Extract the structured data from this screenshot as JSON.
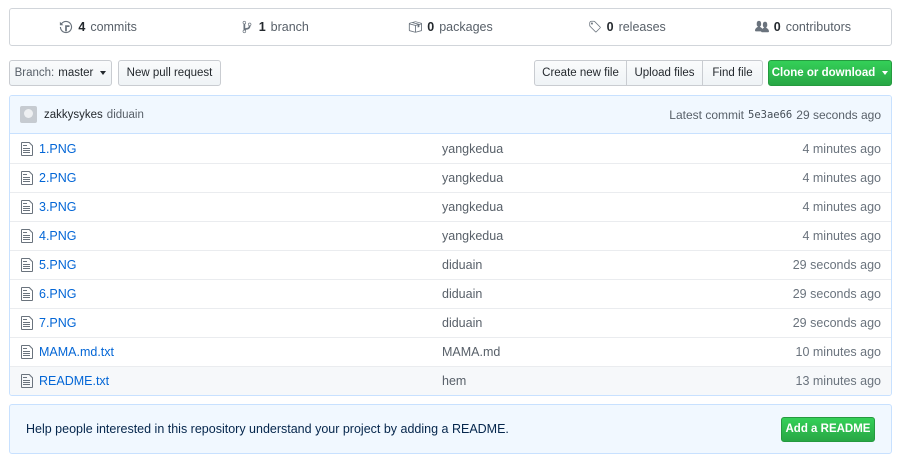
{
  "summary": {
    "commits": {
      "count": "4",
      "label": "commits"
    },
    "branches": {
      "count": "1",
      "label": "branch"
    },
    "packages": {
      "count": "0",
      "label": "packages"
    },
    "releases": {
      "count": "0",
      "label": "releases"
    },
    "contributors": {
      "count": "0",
      "label": "contributors"
    }
  },
  "toolbar": {
    "branch_prefix": "Branch:",
    "branch_name": "master",
    "new_pr": "New pull request",
    "create_file": "Create new file",
    "upload_files": "Upload files",
    "find_file": "Find file",
    "clone": "Clone or download"
  },
  "commit": {
    "author": "zakkysykes",
    "message": "diduain",
    "latest_label": "Latest commit",
    "sha": "5e3ae66",
    "age": "29 seconds ago"
  },
  "files": [
    {
      "name": "1.PNG",
      "message": "yangkedua",
      "age": "4 minutes ago"
    },
    {
      "name": "2.PNG",
      "message": "yangkedua",
      "age": "4 minutes ago"
    },
    {
      "name": "3.PNG",
      "message": "yangkedua",
      "age": "4 minutes ago"
    },
    {
      "name": "4.PNG",
      "message": "yangkedua",
      "age": "4 minutes ago"
    },
    {
      "name": "5.PNG",
      "message": "diduain",
      "age": "29 seconds ago"
    },
    {
      "name": "6.PNG",
      "message": "diduain",
      "age": "29 seconds ago"
    },
    {
      "name": "7.PNG",
      "message": "diduain",
      "age": "29 seconds ago"
    },
    {
      "name": "MAMA.md.txt",
      "message": "MAMA.md",
      "age": "10 minutes ago"
    },
    {
      "name": "README.txt",
      "message": "hem",
      "age": "13 minutes ago"
    }
  ],
  "readme_prompt": {
    "text": "Help people interested in this repository understand your project by adding a README.",
    "button": "Add a README"
  },
  "colors": {
    "link": "#0366d6",
    "green": "#28a745",
    "info_bg": "#f1f8ff"
  }
}
